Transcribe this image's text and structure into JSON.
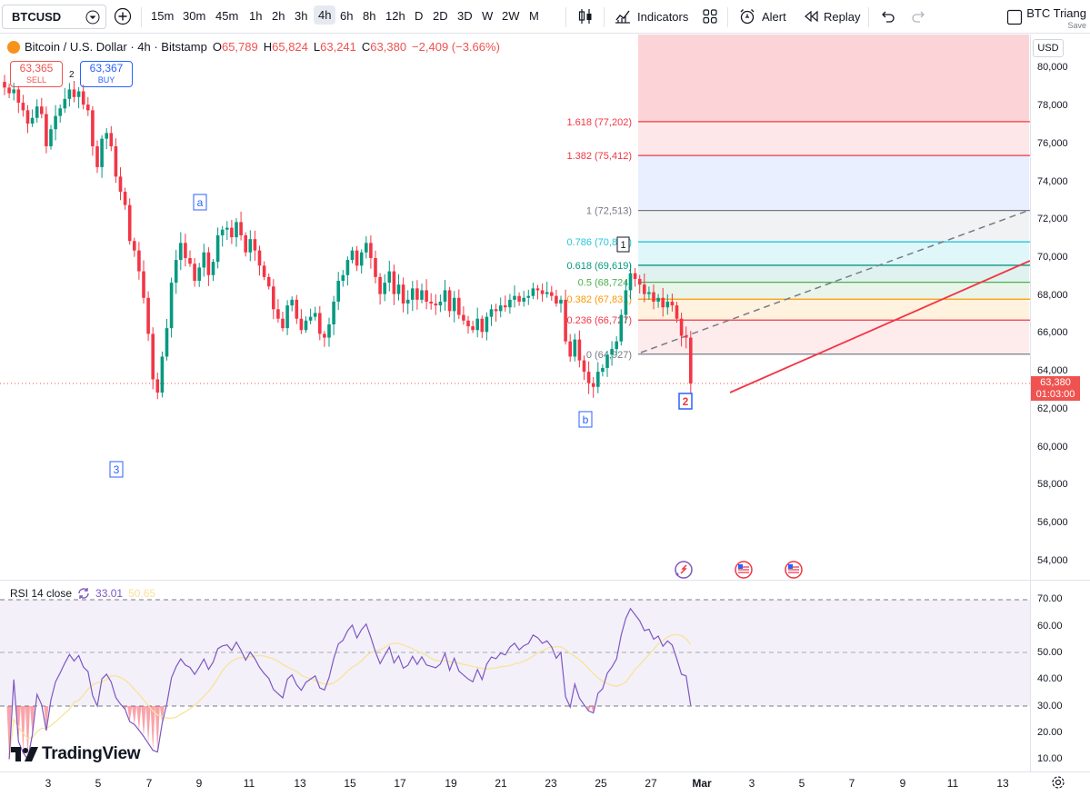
{
  "toolbar": {
    "symbol": "BTCUSD",
    "timeframes": [
      "15m",
      "30m",
      "45m",
      "1h",
      "2h",
      "3h",
      "4h",
      "6h",
      "8h",
      "12h",
      "D",
      "2D",
      "3D",
      "W",
      "2W",
      "M"
    ],
    "active_timeframe": "4h",
    "indicators_label": "Indicators",
    "alert_label": "Alert",
    "replay_label": "Replay",
    "layout_name": "BTC Triang",
    "layout_save": "Save"
  },
  "legend": {
    "title": "Bitcoin / U.S. Dollar · 4h · Bitstamp",
    "open_label": "O",
    "open": "65,789",
    "high_label": "H",
    "high": "65,824",
    "low_label": "L",
    "low": "63,241",
    "close_label": "C",
    "close": "63,380",
    "change": "−2,409 (−3.66%)",
    "sell_price": "63,365",
    "sell_label": "SELL",
    "buy_price": "63,367",
    "buy_label": "BUY",
    "spread": "2"
  },
  "price_scale": {
    "currency": "USD",
    "ticks": [
      "80,000",
      "78,000",
      "76,000",
      "74,000",
      "72,000",
      "70,000",
      "68,000",
      "66,000",
      "64,000",
      "62,000",
      "60,000",
      "58,000",
      "56,000",
      "54,000"
    ],
    "last_price": "63,380",
    "countdown": "01:03:00"
  },
  "fib_levels": [
    {
      "label": "1.618 (77,202)",
      "price": 77202,
      "color": "#f23645"
    },
    {
      "label": "1.382 (75,412)",
      "price": 75412,
      "color": "#f23645"
    },
    {
      "label": "1 (72,513)",
      "price": 72513,
      "color": "#787b86"
    },
    {
      "label": "0.786 (70,854)",
      "price": 70854,
      "color": "#26c6da"
    },
    {
      "label": "0.618 (69,619)",
      "price": 69619,
      "color": "#089981"
    },
    {
      "label": "0.5 (68,724)",
      "price": 68724,
      "color": "#4caf50"
    },
    {
      "label": "0.382 (67,831)",
      "price": 67831,
      "color": "#ff9800"
    },
    {
      "label": "0.236 (66,727)",
      "price": 66727,
      "color": "#f23645"
    },
    {
      "label": "0 (64,927)",
      "price": 64927,
      "color": "#787b86"
    }
  ],
  "wave_labels": [
    "a",
    "3",
    "b",
    "1",
    "2"
  ],
  "rsi": {
    "label": "RSI 14 close",
    "value": "33.01",
    "ma_value": "50.65",
    "ticks": [
      "70.00",
      "60.00",
      "50.00",
      "40.00",
      "30.00",
      "20.00",
      "10.00"
    ]
  },
  "time_axis": {
    "ticks": [
      "3",
      "5",
      "7",
      "9",
      "11",
      "13",
      "15",
      "17",
      "19",
      "21",
      "23",
      "25",
      "27",
      "Mar",
      "3",
      "5",
      "7",
      "9",
      "11",
      "13"
    ]
  },
  "brand": "TradingView",
  "colors": {
    "up": "#089981",
    "down": "#f23645",
    "rsi_line": "#7e57c2",
    "rsi_ma": "#f7e39a"
  },
  "chart_data": {
    "type": "candlestick",
    "title": "Bitcoin / U.S. Dollar · 4h · Bitstamp",
    "ylim": [
      53000,
      81000
    ],
    "grid": false,
    "x_categories": [
      "3",
      "5",
      "7",
      "9",
      "11",
      "13",
      "15",
      "17",
      "19",
      "21",
      "23",
      "25",
      "27",
      "Mar",
      "3",
      "5",
      "7",
      "9",
      "11",
      "13"
    ],
    "series": [
      {
        "name": "BTCUSD",
        "close": [
          79000,
          78700,
          78900,
          78200,
          77800,
          77100,
          77400,
          78000,
          77600,
          75900,
          76800,
          77500,
          77900,
          78400,
          78900,
          78500,
          78800,
          78100,
          77800,
          75900,
          74800,
          76300,
          76600,
          75900,
          74300,
          73500,
          72800,
          70900,
          70400,
          69300,
          67900,
          66000,
          63600,
          62900,
          64800,
          66300,
          68700,
          69900,
          70800,
          70000,
          69700,
          68800,
          69500,
          70300,
          69100,
          69800,
          71200,
          71500,
          71600,
          71100,
          71900,
          71200,
          70300,
          71000,
          70400,
          69600,
          69000,
          68500,
          67300,
          66800,
          66300,
          67500,
          67800,
          66800,
          66200,
          66700,
          66900,
          67100,
          66000,
          65800,
          66500,
          67700,
          68800,
          69100,
          69900,
          70400,
          69600,
          70300,
          70800,
          70000,
          69000,
          68100,
          68700,
          69300,
          68100,
          68600,
          67600,
          67800,
          68400,
          67800,
          68300,
          67700,
          67600,
          67500,
          67700,
          68300,
          67200,
          67900,
          67000,
          66700,
          66400,
          66200,
          66800,
          66100,
          66900,
          67300,
          67200,
          67500,
          67400,
          67800,
          68000,
          67700,
          67900,
          68000,
          68400,
          68300,
          68100,
          68200,
          68000,
          67600,
          67800,
          65600,
          64800,
          65700,
          64600,
          64000,
          63400,
          63200,
          64000,
          64200,
          64900,
          65200,
          65600,
          67000,
          68300,
          69200,
          68900,
          68600,
          68100,
          68200,
          67700,
          67900,
          67400,
          67700,
          67500,
          66800,
          65900,
          65800,
          63380
        ]
      }
    ]
  }
}
